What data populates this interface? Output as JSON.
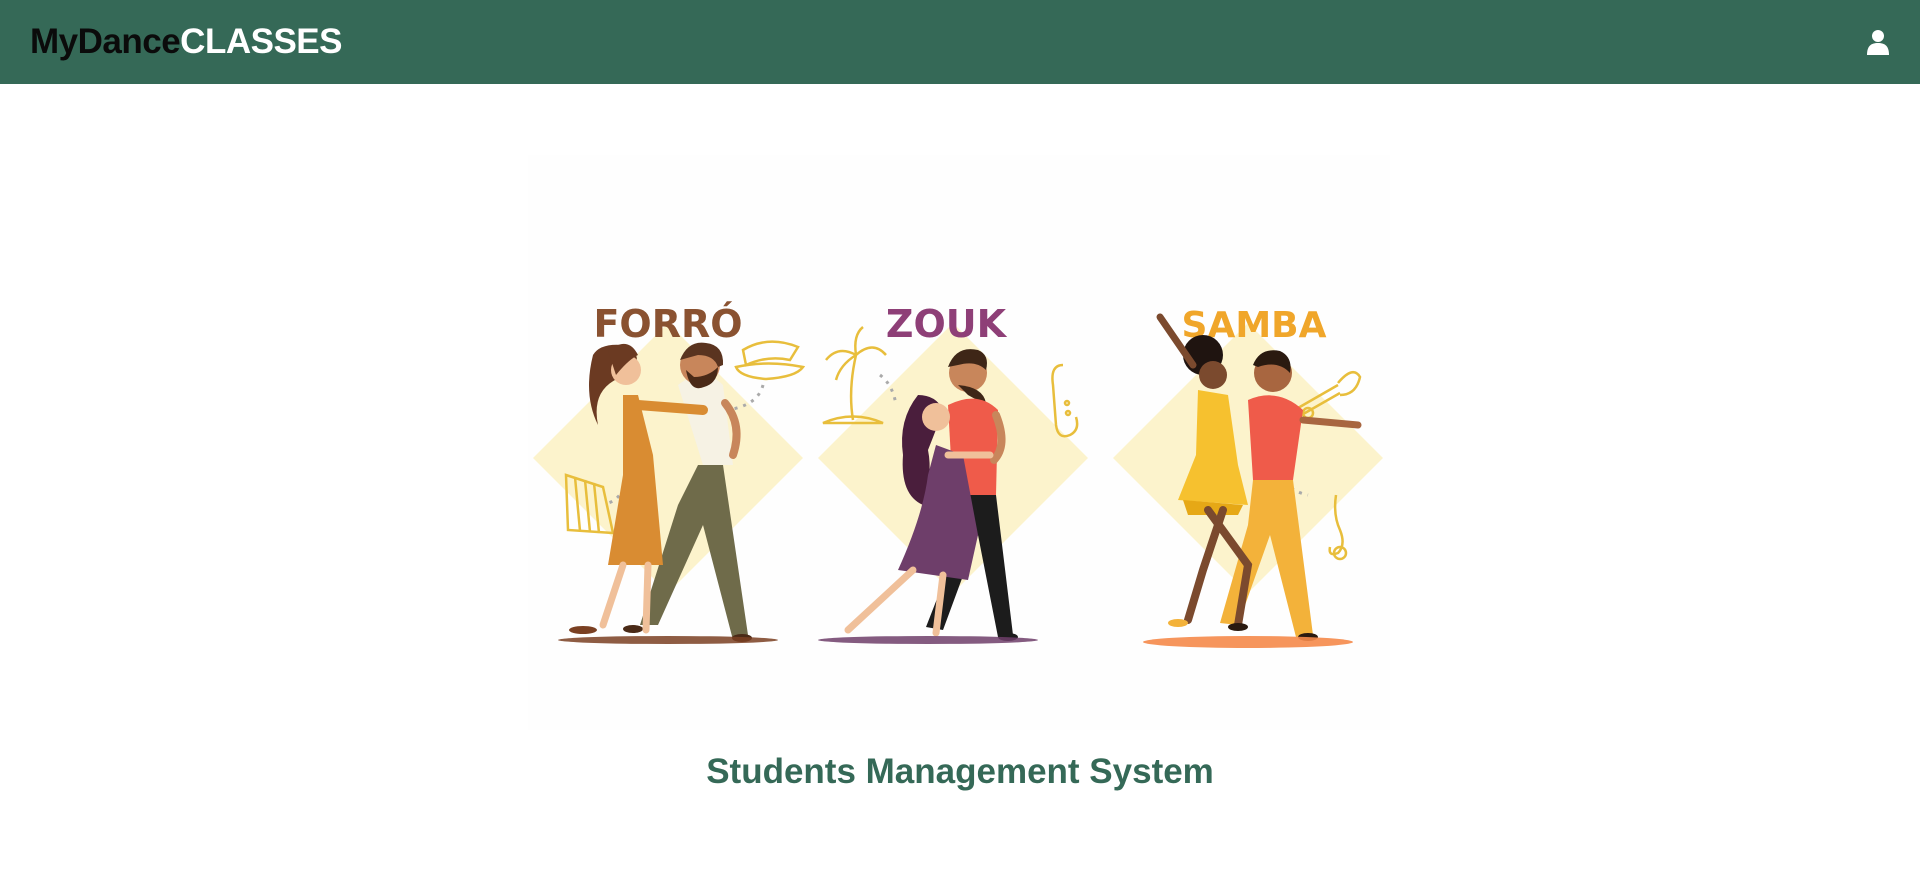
{
  "navbar": {
    "brand_my": "MyDance",
    "brand_classes": "CLASSES",
    "user_icon": "user-icon"
  },
  "hero": {
    "panels": [
      {
        "label": "FORRÓ",
        "color": "#8a5231",
        "icons": [
          "hat-icon",
          "accordion-icon"
        ]
      },
      {
        "label": "ZOUK",
        "color": "#8e3f77",
        "icons": [
          "palm-tree-icon",
          "saxophone-icon"
        ]
      },
      {
        "label": "SAMBA",
        "color": "#f0a62a",
        "icons": [
          "trumpet-icon",
          "music-note-icon"
        ]
      }
    ]
  },
  "page": {
    "title": "Students Management System"
  },
  "colors": {
    "navbar": "#356957",
    "title": "#356957",
    "diamond": "#fcf3cc"
  }
}
